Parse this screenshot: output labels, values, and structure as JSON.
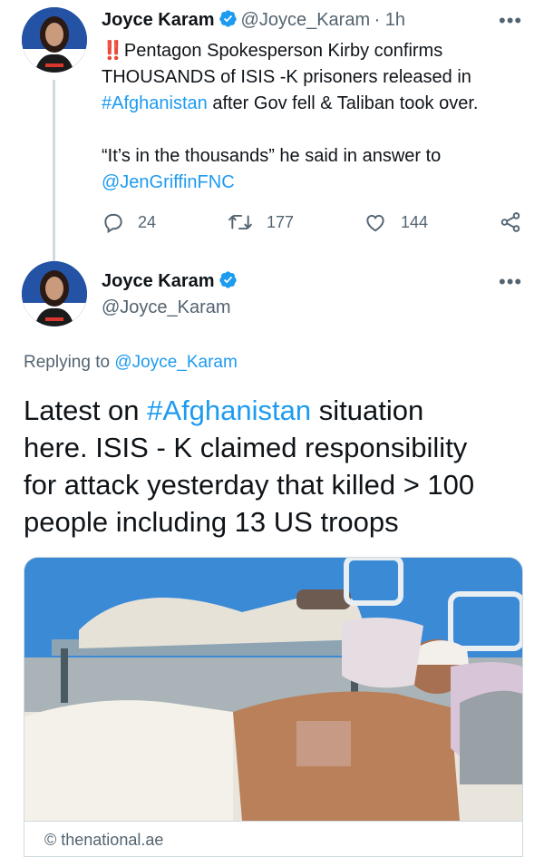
{
  "tweet1": {
    "name": "Joyce Karam",
    "handle": "@Joyce_Karam",
    "time": "· 1h",
    "more": "•••",
    "alert_emoji": "‼️",
    "line1": "Pentagon Spokesperson Kirby confirms",
    "line2": "THOUSANDS of ISIS -K prisoners released in",
    "hashtag": "#Afghanistan",
    "line3_rest": " after Gov fell & Taliban took over.",
    "quote": "“It’s in the thousands” he said in answer to",
    "mention": "@JenGriffinFNC",
    "replies": "24",
    "retweets": "177",
    "likes": "144"
  },
  "tweet2": {
    "name": "Joyce Karam",
    "handle": "@Joyce_Karam",
    "more": "•••",
    "replying_prefix": "Replying to ",
    "replying_handle": "@Joyce_Karam",
    "text_start": "Latest on ",
    "hashtag": "#Afghanistan",
    "text_line1_end": " situation",
    "text_line2": "here. ISIS - K claimed responsibility",
    "text_line3": "for attack yesterday that killed > 100",
    "text_line4": "people including 13 US troops",
    "card_text": "© thenational.ae"
  },
  "colors": {
    "link": "#1d9bf0",
    "secondary": "#536471",
    "divider": "#cfd9de"
  },
  "icons": [
    "verified-badge-icon",
    "more-icon",
    "reply-icon",
    "retweet-icon",
    "like-icon",
    "share-icon"
  ]
}
